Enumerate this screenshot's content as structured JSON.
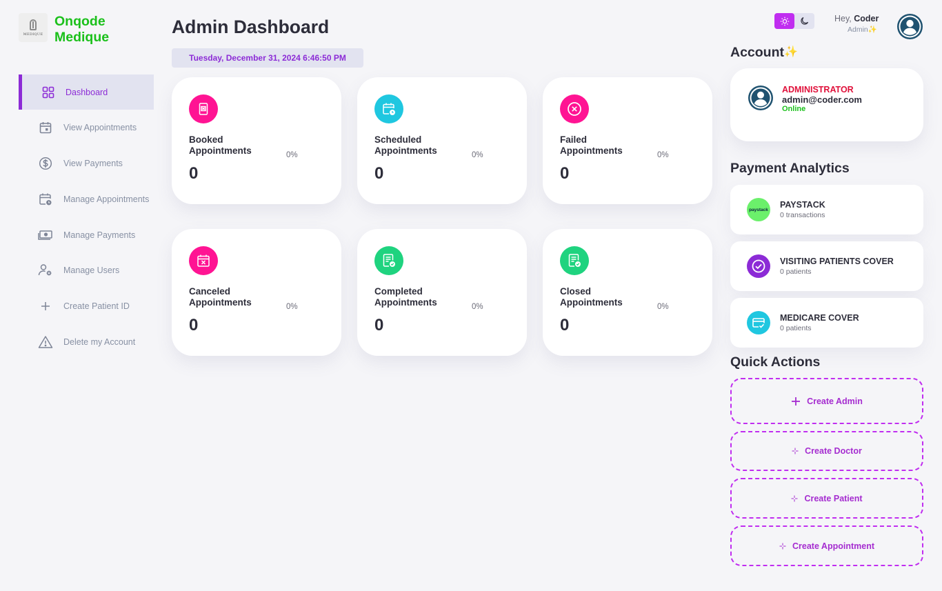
{
  "brand": {
    "logo_text": "MEDIQUE",
    "name_line1": "Onqode",
    "name_line2": "Medique"
  },
  "sidebar": {
    "items": [
      {
        "label": "Dashboard",
        "icon": "dashboard-grid-icon",
        "active": true
      },
      {
        "label": "View Appointments",
        "icon": "calendar-icon"
      },
      {
        "label": "View Payments",
        "icon": "dollar-circle-icon"
      },
      {
        "label": "Manage Appointments",
        "icon": "calendar-clock-icon"
      },
      {
        "label": "Manage Payments",
        "icon": "cash-icon"
      },
      {
        "label": "Manage Users",
        "icon": "user-gear-icon"
      },
      {
        "label": "Create Patient ID",
        "icon": "plus-icon"
      },
      {
        "label": "Delete my Account",
        "icon": "warning-icon"
      }
    ]
  },
  "header": {
    "title": "Admin Dashboard",
    "datetime": "Tuesday, December 31, 2024 6:46:50 PM",
    "greeting_prefix": "Hey, ",
    "user_name": "Coder",
    "user_role": "Admin"
  },
  "stats": [
    {
      "line1": "Booked",
      "line2": "Appointments",
      "percent": "0%",
      "count": "0",
      "color": "#ff1493",
      "icon": "booked-icon"
    },
    {
      "line1": "Scheduled",
      "line2": "Appointments",
      "percent": "0%",
      "count": "0",
      "color": "#1fc7e0",
      "icon": "scheduled-calendar-icon"
    },
    {
      "line1": "Failed",
      "line2": "Appointments",
      "percent": "0%",
      "count": "0",
      "color": "#ff1493",
      "icon": "x-circle-icon"
    },
    {
      "line1": "Canceled",
      "line2": "Appointments",
      "percent": "0%",
      "count": "0",
      "color": "#ff1493",
      "icon": "calendar-x-icon"
    },
    {
      "line1": "Completed",
      "line2": "Appointments",
      "percent": "0%",
      "count": "0",
      "color": "#1fd37f",
      "icon": "document-check-icon"
    },
    {
      "line1": "Closed",
      "line2": "Appointments",
      "percent": "0%",
      "count": "0",
      "color": "#1fd37f",
      "icon": "document-check-icon"
    }
  ],
  "account": {
    "title": "Account",
    "role": "ADMINISTRATOR",
    "email": "admin@coder.com",
    "status": "Online"
  },
  "payment_analytics": {
    "title": "Payment Analytics",
    "items": [
      {
        "name": "PAYSTACK",
        "sub": "0 transactions",
        "logo_text": "paystack",
        "color": "#6bf06b"
      },
      {
        "name": "VISITING PATIENTS COVER",
        "sub": "0 patients",
        "color": "#8c2bd6"
      },
      {
        "name": "MEDICARE COVER",
        "sub": "0 patients",
        "color": "#1fc7e0"
      }
    ]
  },
  "quick_actions": {
    "title": "Quick Actions",
    "items": [
      {
        "label": "Create Admin"
      },
      {
        "label": "Create Doctor"
      },
      {
        "label": "Create Patient"
      },
      {
        "label": "Create Appointment"
      }
    ]
  },
  "colors": {
    "accent": "#8c2bd6",
    "brand": "#1bc01b",
    "quick_action": "#c02df0",
    "danger": "#e0103a"
  }
}
